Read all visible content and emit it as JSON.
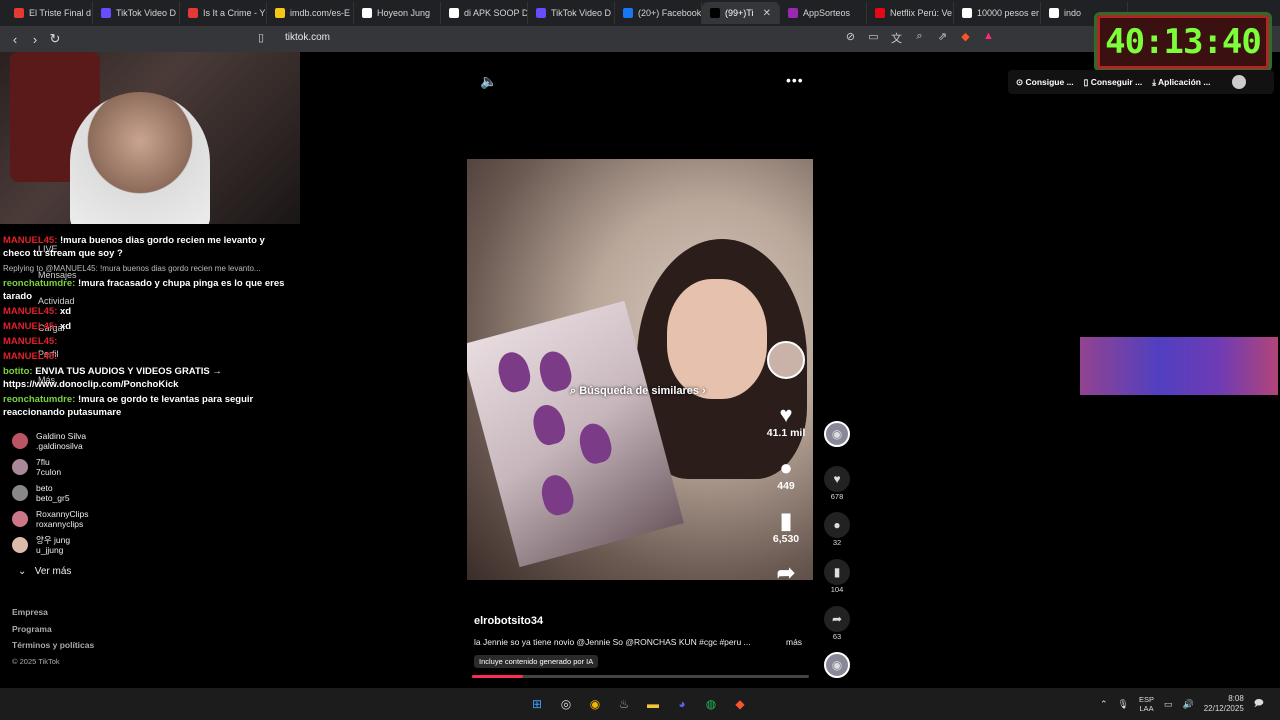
{
  "browser": {
    "tabs": [
      {
        "label": "El Triste Final d",
        "color": "#e53935",
        "active": false
      },
      {
        "label": "TikTok Video D",
        "color": "#6a4cff",
        "active": false
      },
      {
        "label": "Is It a Crime - Y",
        "color": "#e53935",
        "active": false
      },
      {
        "label": "imdb.com/es-E",
        "color": "#f5c518",
        "active": false
      },
      {
        "label": "Hoyeon Jung",
        "color": "#ffffff",
        "active": false
      },
      {
        "label": "di APK SOOP D",
        "color": "#ffffff",
        "active": false
      },
      {
        "label": "TikTok Video D",
        "color": "#6a4cff",
        "active": false
      },
      {
        "label": "(20+) Facebook",
        "color": "#1877f2",
        "active": false
      },
      {
        "label": "(99+)Ti",
        "color": "#000000",
        "active": true
      },
      {
        "label": "AppSorteos",
        "color": "#9c27b0",
        "active": false
      },
      {
        "label": "Netflix Perú: Ve",
        "color": "#e50914",
        "active": false
      },
      {
        "label": "10000 pesos er",
        "color": "#ffffff",
        "active": false
      },
      {
        "label": "indo",
        "color": "#ffffff",
        "active": false
      }
    ],
    "url": "tiktok.com"
  },
  "timer": {
    "value": "40:13:40"
  },
  "chat": {
    "messages": [
      {
        "user": "MANUEL45:",
        "user_color": "red",
        "text": "!mura buenos dias gordo recien me levanto y checo tu stream que soy ?"
      },
      {
        "reply": "Replying to @MANUEL45: !mura buenos dias gordo recien me levanto..."
      },
      {
        "user": "reonchatumdre:",
        "user_color": "green",
        "text": "!mura fracasado y chupa pinga es lo que eres tarado"
      },
      {
        "user": "MANUEL45:",
        "user_color": "red",
        "text": "xd"
      },
      {
        "user": "MANUEL45:",
        "user_color": "red",
        "text": "xd"
      },
      {
        "user": "MANUEL45:",
        "user_color": "red",
        "text": ""
      },
      {
        "user": "MANUEL45:",
        "user_color": "red",
        "text": ""
      },
      {
        "user": "botito:",
        "user_color": "green",
        "text": "ENVIA TUS AUDIOS Y VIDEOS GRATIS → https://www.donoclip.com/PonchoKick"
      },
      {
        "user": "reonchatumdre:",
        "user_color": "green",
        "text": "!mura oe gordo te levantas para seguir reaccionando putasumare"
      }
    ]
  },
  "sidebar": {
    "ghost_items": [
      "LIVE",
      "Mensajes",
      "Actividad",
      "Cargar",
      "Perfil",
      "Más"
    ],
    "following": [
      {
        "name": "Galdino Silva",
        "handle": ".galdinosilva",
        "color": "#b56"
      },
      {
        "name": "7flu",
        "handle": "7culon",
        "color": "#a89"
      },
      {
        "name": "beto",
        "handle": "beto_gr5",
        "color": "#888"
      },
      {
        "name": "RoxannyClips",
        "handle": "roxannyclips",
        "color": "#c78"
      },
      {
        "name": "양우 jung",
        "handle": "u_jjung",
        "color": "#dba"
      }
    ],
    "see_more": "Ver más",
    "footer_links": [
      "Empresa",
      "Programa",
      "Términos y políticas"
    ],
    "copyright": "© 2025 TikTok"
  },
  "video": {
    "search_similar": "Búsqueda de similares",
    "likes": "41.1 mil",
    "comments": "449",
    "saves": "6,530",
    "author": "elrobotsito34",
    "caption": "la Jennie so ya tiene novio @Jennie So @RONCHAS KUN #cgc #peru ...",
    "more": "más",
    "ai_label": "Incluye contenido generado por IA",
    "progress": 0.15
  },
  "right_column": {
    "likes": "678",
    "comments": "32",
    "saves": "104",
    "shares": "63"
  },
  "top_right": {
    "items": [
      "Consigue ...",
      "Conseguir ...",
      "Aplicación ..."
    ]
  },
  "taskbar": {
    "lang_top": "ESP",
    "lang_bottom": "LAA",
    "time": "8:08",
    "date": "22/12/2025"
  },
  "icons": {
    "volume": "speaker-icon",
    "more": "ellipsis-icon",
    "heart": "heart-icon",
    "comment": "comment-icon",
    "bookmark": "bookmark-icon",
    "share": "share-icon"
  }
}
